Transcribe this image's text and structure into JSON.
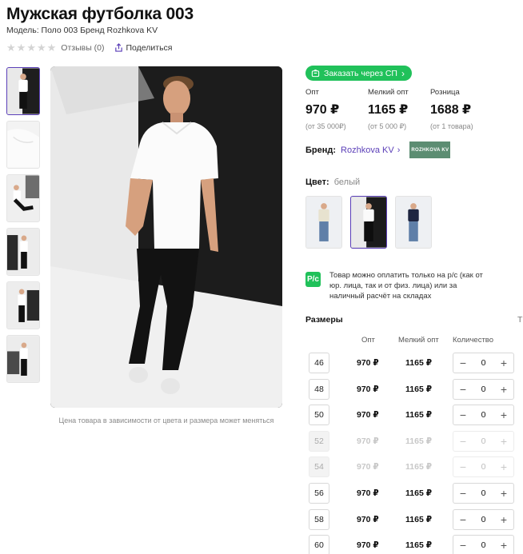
{
  "product": {
    "title": "Мужская футболка 003",
    "model_line": "Модель: Поло 003 Бренд Rozhkova KV",
    "reviews_label": "Отзывы (0)",
    "share_label": "Поделиться",
    "image_caption": "Цена товара в зависимости от цвета и размера может меняться"
  },
  "order_button": {
    "label": "Заказать через СП",
    "color": "#20c15a"
  },
  "prices": [
    {
      "label": "Опт",
      "value": "970 ₽",
      "note": "(от 35 000₽)"
    },
    {
      "label": "Мелкий опт",
      "value": "1165 ₽",
      "note": "(от 5 000 ₽)"
    },
    {
      "label": "Розница",
      "value": "1688 ₽",
      "note": "(от 1 товара)"
    }
  ],
  "brand": {
    "label": "Бренд:",
    "name": "Rozhkova KV",
    "logo_text": "ROZHKOVA KV",
    "link_color": "#5b3fb8"
  },
  "color": {
    "label": "Цвет:",
    "value": "белый"
  },
  "payment": {
    "icon_text": "P/c",
    "text": "Товар можно оплатить только на р/с (как от юр. лица, так и от физ. лица) или за наличный расчёт на складах"
  },
  "sizes": {
    "title": "Размеры",
    "link": "Т",
    "headers": {
      "opt": "Опт",
      "small_opt": "Мелкий опт",
      "quantity": "Количество"
    },
    "rows": [
      {
        "size": "46",
        "opt": "970 ₽",
        "small_opt": "1165 ₽",
        "qty": "0",
        "available": true
      },
      {
        "size": "48",
        "opt": "970 ₽",
        "small_opt": "1165 ₽",
        "qty": "0",
        "available": true
      },
      {
        "size": "50",
        "opt": "970 ₽",
        "small_opt": "1165 ₽",
        "qty": "0",
        "available": true
      },
      {
        "size": "52",
        "opt": "970 ₽",
        "small_opt": "1165 ₽",
        "qty": "0",
        "available": false
      },
      {
        "size": "54",
        "opt": "970 ₽",
        "small_opt": "1165 ₽",
        "qty": "0",
        "available": false
      },
      {
        "size": "56",
        "opt": "970 ₽",
        "small_opt": "1165 ₽",
        "qty": "0",
        "available": true
      },
      {
        "size": "58",
        "opt": "970 ₽",
        "small_opt": "1165 ₽",
        "qty": "0",
        "available": true
      },
      {
        "size": "60",
        "opt": "970 ₽",
        "small_opt": "1165 ₽",
        "qty": "0",
        "available": true
      }
    ],
    "minus": "−",
    "plus": "+"
  },
  "icons": [
    "star-icon",
    "share-icon",
    "cart-icon",
    "chevron-right-icon",
    "minus-icon",
    "plus-icon"
  ]
}
